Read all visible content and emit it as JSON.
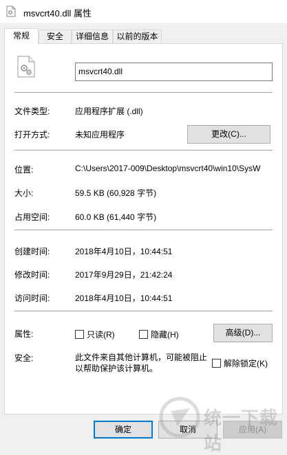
{
  "window": {
    "title": "msvcrt40.dll 属性"
  },
  "tabs": [
    {
      "label": "常规",
      "active": true
    },
    {
      "label": "安全"
    },
    {
      "label": "详细信息"
    },
    {
      "label": "以前的版本"
    }
  ],
  "general": {
    "file_name": "msvcrt40.dll",
    "file_type_label": "文件类型:",
    "file_type_value": "应用程序扩展 (.dll)",
    "open_with_label": "打开方式:",
    "open_with_value": "未知应用程序",
    "change_button": "更改(C)...",
    "location_label": "位置:",
    "location_value": "C:\\Users\\2017-009\\Desktop\\msvcrt40\\win10\\SysW",
    "size_label": "大小:",
    "size_value": "59.5 KB (60,928 字节)",
    "size_on_disk_label": "占用空间:",
    "size_on_disk_value": "60.0 KB (61,440 字节)",
    "created_label": "创建时间:",
    "created_value": "2018年4月10日，10:44:51",
    "modified_label": "修改时间:",
    "modified_value": "2017年9月29日，21:42:24",
    "accessed_label": "访问时间:",
    "accessed_value": "2018年4月10日，10:44:51",
    "attributes_label": "属性:",
    "readonly_label": "只读(R)",
    "hidden_label": "隐藏(H)",
    "advanced_button": "高级(D)...",
    "security_label": "安全:",
    "security_text_line1": "此文件来自其他计算机，可能被阻止",
    "security_text_line2": "以帮助保护该计算机。",
    "unblock_label": "解除锁定(K)"
  },
  "footer": {
    "ok_button": "确定",
    "cancel_button": "取消",
    "apply_button": "应用(A)"
  },
  "watermark": {
    "text": "统一下载站"
  },
  "colors": {
    "accent": "#0078d7",
    "separator": "#a0a0a0"
  }
}
